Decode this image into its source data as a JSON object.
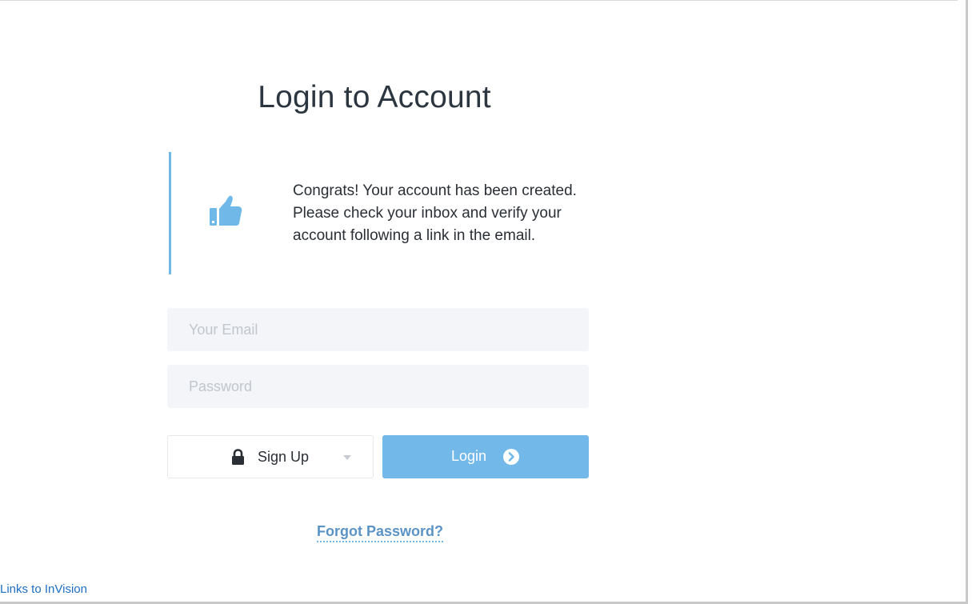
{
  "page": {
    "title": "Login to Account"
  },
  "notice": {
    "icon": "thumbs-up-icon",
    "message": "Congrats! Your account has been created. Please check your inbox and verify your account following a link in the email.",
    "accent_color": "#6fb8e8"
  },
  "form": {
    "email_placeholder": "Your Email",
    "email_value": "",
    "password_placeholder": "Password",
    "password_value": ""
  },
  "actions": {
    "signup_label": "Sign Up",
    "signup_icon": "lock-icon",
    "signup_caret_icon": "chevron-down-icon",
    "login_label": "Login",
    "login_icon": "arrow-circle-right-icon",
    "login_color": "#72b9e9",
    "forgot_label": "Forgot Password?"
  },
  "footer": {
    "link_label": "Links to InVision"
  }
}
